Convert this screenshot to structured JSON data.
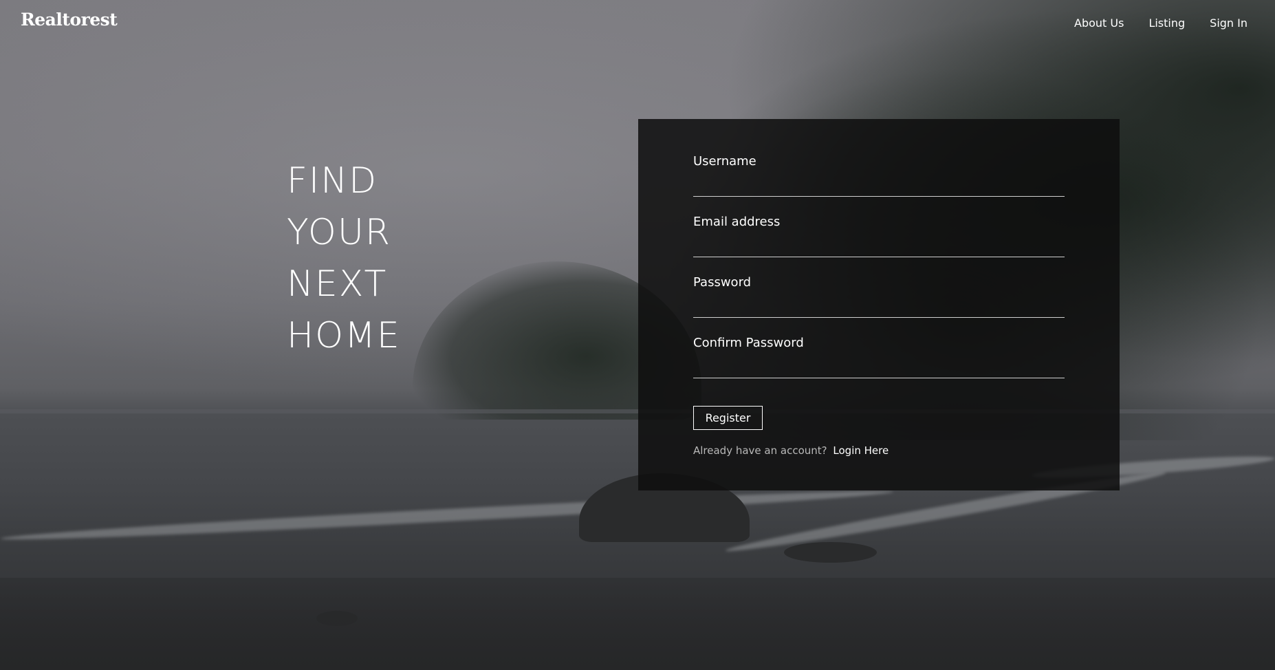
{
  "brand": {
    "name": "Realtorest"
  },
  "nav": {
    "items": [
      {
        "label": "About Us"
      },
      {
        "label": "Listing"
      },
      {
        "label": "Sign In"
      }
    ]
  },
  "hero": {
    "lines": [
      "FIND",
      "YOUR",
      "NEXT",
      "HOME"
    ]
  },
  "form": {
    "fields": [
      {
        "label": "Username",
        "value": ""
      },
      {
        "label": "Email address",
        "value": ""
      },
      {
        "label": "Password",
        "value": ""
      },
      {
        "label": "Confirm Password",
        "value": ""
      }
    ],
    "submit_label": "Register",
    "login_prompt": "Already have an account?",
    "login_link": "Login Here"
  },
  "colors": {
    "panel_background": "#0e0e0e",
    "text_primary": "#ffffff",
    "text_muted": "#b9b9b9"
  }
}
